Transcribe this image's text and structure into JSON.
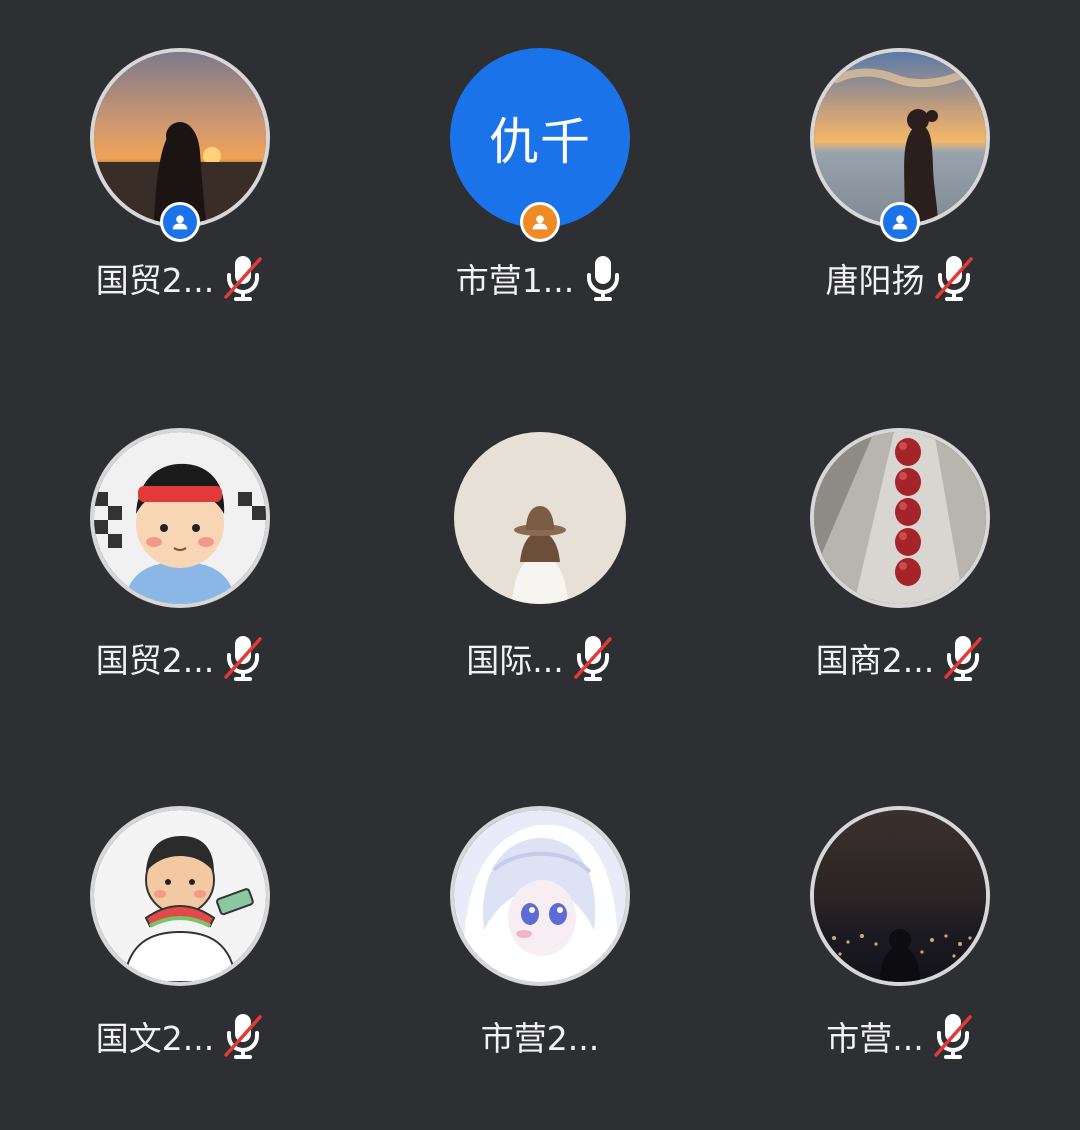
{
  "participants": [
    {
      "name": "国贸2...",
      "avatar": "photo-sunset-silhouette",
      "badge": "host",
      "mic": "muted"
    },
    {
      "name": "市营1...",
      "avatar_text": "仇千",
      "avatar": "text",
      "badge": "cohost",
      "mic": "on"
    },
    {
      "name": "唐阳扬",
      "avatar": "photo-sea-silhouette",
      "badge": "host",
      "mic": "muted"
    },
    {
      "name": "国贸2...",
      "avatar": "cartoon-boy",
      "badge": null,
      "mic": "muted"
    },
    {
      "name": "国际...",
      "avatar": "photo-hat-girl",
      "badge": null,
      "mic": "muted"
    },
    {
      "name": "国商2...",
      "avatar": "photo-hawthorn",
      "badge": null,
      "mic": "muted"
    },
    {
      "name": "国文2...",
      "avatar": "cartoon-watermelon",
      "badge": null,
      "mic": "muted"
    },
    {
      "name": "市营2...",
      "avatar": "anime-girl",
      "badge": null,
      "mic": null
    },
    {
      "name": "市营...",
      "avatar": "photo-night",
      "badge": null,
      "mic": "muted"
    }
  ],
  "colors": {
    "background": "#2e2f33",
    "host_badge": "#1a73e8",
    "cohost_badge": "#f08a24",
    "text_avatar": "#1a73e8",
    "muted_slash": "#e53935"
  }
}
